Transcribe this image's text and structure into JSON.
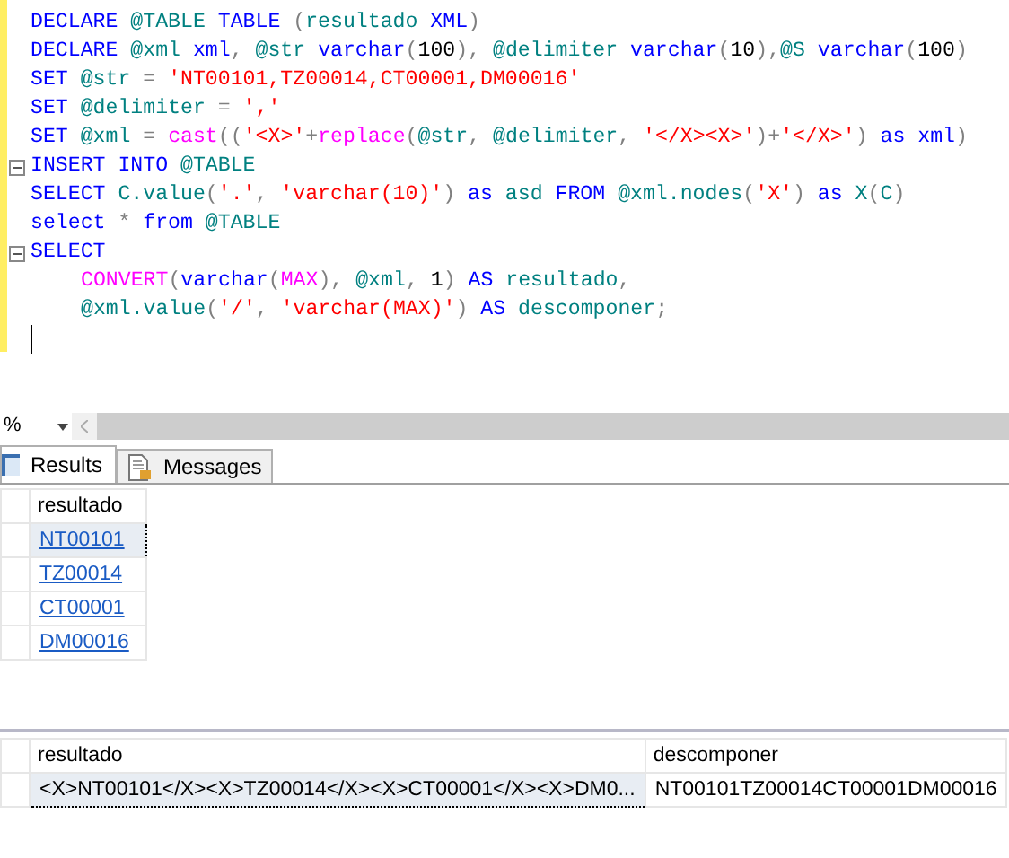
{
  "editor": {
    "lines": [
      {
        "fold": false,
        "tokens": [
          {
            "kind": "keyword",
            "text": "DECLARE "
          },
          {
            "kind": "identifier",
            "text": "@TABLE "
          },
          {
            "kind": "keyword",
            "text": "TABLE "
          },
          {
            "kind": "punct",
            "text": "("
          },
          {
            "kind": "identifier",
            "text": "resultado "
          },
          {
            "kind": "keyword",
            "text": "XML"
          },
          {
            "kind": "punct",
            "text": ")"
          }
        ]
      },
      {
        "fold": false,
        "tokens": [
          {
            "kind": "keyword",
            "text": "DECLARE "
          },
          {
            "kind": "identifier",
            "text": "@xml "
          },
          {
            "kind": "keyword",
            "text": "xml"
          },
          {
            "kind": "punct",
            "text": ", "
          },
          {
            "kind": "identifier",
            "text": "@str "
          },
          {
            "kind": "keyword",
            "text": "varchar"
          },
          {
            "kind": "punct",
            "text": "("
          },
          {
            "kind": "number",
            "text": "100"
          },
          {
            "kind": "punct",
            "text": "), "
          },
          {
            "kind": "identifier",
            "text": "@delimiter "
          },
          {
            "kind": "keyword",
            "text": "varchar"
          },
          {
            "kind": "punct",
            "text": "("
          },
          {
            "kind": "number",
            "text": "10"
          },
          {
            "kind": "punct",
            "text": "),"
          },
          {
            "kind": "identifier",
            "text": "@S "
          },
          {
            "kind": "keyword",
            "text": "varchar"
          },
          {
            "kind": "punct",
            "text": "("
          },
          {
            "kind": "number",
            "text": "100"
          },
          {
            "kind": "punct",
            "text": ")"
          }
        ]
      },
      {
        "fold": false,
        "tokens": [
          {
            "kind": "keyword",
            "text": "SET "
          },
          {
            "kind": "identifier",
            "text": "@str "
          },
          {
            "kind": "punct",
            "text": "= "
          },
          {
            "kind": "string",
            "text": "'NT00101,TZ00014,CT00001,DM00016'"
          }
        ]
      },
      {
        "fold": false,
        "tokens": [
          {
            "kind": "keyword",
            "text": "SET "
          },
          {
            "kind": "identifier",
            "text": "@delimiter "
          },
          {
            "kind": "punct",
            "text": "= "
          },
          {
            "kind": "string",
            "text": "','"
          }
        ]
      },
      {
        "fold": false,
        "tokens": [
          {
            "kind": "keyword",
            "text": "SET "
          },
          {
            "kind": "identifier",
            "text": "@xml "
          },
          {
            "kind": "punct",
            "text": "= "
          },
          {
            "kind": "function",
            "text": "cast"
          },
          {
            "kind": "punct",
            "text": "(("
          },
          {
            "kind": "string",
            "text": "'<X>'"
          },
          {
            "kind": "punct",
            "text": "+"
          },
          {
            "kind": "function",
            "text": "replace"
          },
          {
            "kind": "punct",
            "text": "("
          },
          {
            "kind": "identifier",
            "text": "@str"
          },
          {
            "kind": "punct",
            "text": ", "
          },
          {
            "kind": "identifier",
            "text": "@delimiter"
          },
          {
            "kind": "punct",
            "text": ", "
          },
          {
            "kind": "string",
            "text": "'</X><X>'"
          },
          {
            "kind": "punct",
            "text": ")+"
          },
          {
            "kind": "string",
            "text": "'</X>'"
          },
          {
            "kind": "punct",
            "text": ") "
          },
          {
            "kind": "keyword",
            "text": "as xml"
          },
          {
            "kind": "punct",
            "text": ")"
          }
        ]
      },
      {
        "fold": true,
        "tokens": [
          {
            "kind": "keyword",
            "text": "INSERT INTO "
          },
          {
            "kind": "identifier",
            "text": "@TABLE"
          }
        ]
      },
      {
        "fold": false,
        "tokens": [
          {
            "kind": "keyword",
            "text": "SELECT "
          },
          {
            "kind": "identifier",
            "text": "C.value"
          },
          {
            "kind": "punct",
            "text": "("
          },
          {
            "kind": "string",
            "text": "'.'"
          },
          {
            "kind": "punct",
            "text": ", "
          },
          {
            "kind": "string",
            "text": "'varchar(10)'"
          },
          {
            "kind": "punct",
            "text": ") "
          },
          {
            "kind": "keyword",
            "text": "as "
          },
          {
            "kind": "identifier",
            "text": "asd "
          },
          {
            "kind": "keyword",
            "text": "FROM "
          },
          {
            "kind": "identifier",
            "text": "@xml.nodes"
          },
          {
            "kind": "punct",
            "text": "("
          },
          {
            "kind": "string",
            "text": "'X'"
          },
          {
            "kind": "punct",
            "text": ") "
          },
          {
            "kind": "keyword",
            "text": "as "
          },
          {
            "kind": "identifier",
            "text": "X"
          },
          {
            "kind": "punct",
            "text": "("
          },
          {
            "kind": "identifier",
            "text": "C"
          },
          {
            "kind": "punct",
            "text": ")"
          }
        ]
      },
      {
        "fold": false,
        "tokens": [
          {
            "kind": "keyword",
            "text": "select "
          },
          {
            "kind": "punct",
            "text": "* "
          },
          {
            "kind": "keyword",
            "text": "from "
          },
          {
            "kind": "identifier",
            "text": "@TABLE"
          }
        ]
      },
      {
        "fold": true,
        "tokens": [
          {
            "kind": "keyword",
            "text": "SELECT"
          }
        ],
        "children": [
          {
            "fold": false,
            "tokens": [
              {
                "kind": "function",
                "text": "CONVERT"
              },
              {
                "kind": "punct",
                "text": "("
              },
              {
                "kind": "keyword",
                "text": "varchar"
              },
              {
                "kind": "punct",
                "text": "("
              },
              {
                "kind": "function",
                "text": "MAX"
              },
              {
                "kind": "punct",
                "text": "), "
              },
              {
                "kind": "identifier",
                "text": "@xml"
              },
              {
                "kind": "punct",
                "text": ", "
              },
              {
                "kind": "number",
                "text": "1"
              },
              {
                "kind": "punct",
                "text": ") "
              },
              {
                "kind": "keyword",
                "text": "AS "
              },
              {
                "kind": "identifier",
                "text": "resultado"
              },
              {
                "kind": "punct",
                "text": ","
              }
            ]
          },
          {
            "fold": false,
            "tokens": [
              {
                "kind": "identifier",
                "text": "@xml.value"
              },
              {
                "kind": "punct",
                "text": "("
              },
              {
                "kind": "string",
                "text": "'/'"
              },
              {
                "kind": "punct",
                "text": ", "
              },
              {
                "kind": "string",
                "text": "'varchar(MAX)'"
              },
              {
                "kind": "punct",
                "text": ") "
              },
              {
                "kind": "keyword",
                "text": "AS "
              },
              {
                "kind": "identifier",
                "text": "descomponer"
              },
              {
                "kind": "punct",
                "text": ";"
              }
            ]
          }
        ]
      }
    ]
  },
  "zoom": {
    "value": "%"
  },
  "tabs": [
    {
      "label": "Results",
      "selected": true
    },
    {
      "label": "Messages",
      "selected": false
    }
  ],
  "grids": [
    {
      "columns": [
        {
          "label": "resultado"
        }
      ],
      "rows": [
        [
          {
            "text": "NT00101",
            "link": true,
            "selected": true
          }
        ],
        [
          {
            "text": "TZ00014",
            "link": true,
            "selected": false
          }
        ],
        [
          {
            "text": "CT00001",
            "link": true,
            "selected": false
          }
        ],
        [
          {
            "text": "DM00016",
            "link": true,
            "selected": false
          }
        ]
      ]
    },
    {
      "columns": [
        {
          "label": "resultado"
        },
        {
          "label": "descomponer"
        }
      ],
      "rows": [
        [
          {
            "text": "<X>NT00101</X><X>TZ00014</X><X>CT00001</X><X>DM0...",
            "link": false,
            "selected": true
          },
          {
            "text": "NT00101TZ00014CT00001DM00016",
            "link": false,
            "selected": false
          }
        ]
      ]
    }
  ]
}
